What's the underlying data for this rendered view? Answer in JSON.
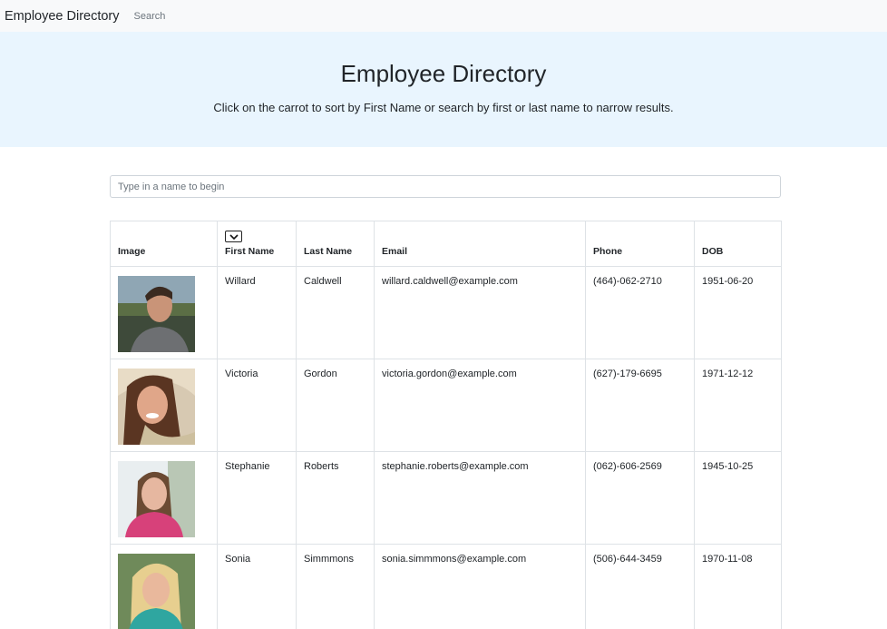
{
  "navbar": {
    "brand": "Employee Directory",
    "search_link": "Search"
  },
  "jumbotron": {
    "title": "Employee Directory",
    "subtitle": "Click on the carrot to sort by First Name or search by first or last name to narrow results."
  },
  "search": {
    "placeholder": "Type in a name to begin"
  },
  "table": {
    "headers": [
      "Image",
      "First Name",
      "Last Name",
      "Email",
      "Phone",
      "DOB"
    ],
    "rows": [
      {
        "first": "Willard",
        "last": "Caldwell",
        "email": "willard.caldwell@example.com",
        "phone": "(464)-062-2710",
        "dob": "1951-06-20"
      },
      {
        "first": "Victoria",
        "last": "Gordon",
        "email": "victoria.gordon@example.com",
        "phone": "(627)-179-6695",
        "dob": "1971-12-12"
      },
      {
        "first": "Stephanie",
        "last": "Roberts",
        "email": "stephanie.roberts@example.com",
        "phone": "(062)-606-2569",
        "dob": "1945-10-25"
      },
      {
        "first": "Sonia",
        "last": "Simmmons",
        "email": "sonia.simmmons@example.com",
        "phone": "(506)-644-3459",
        "dob": "1970-11-08"
      }
    ]
  },
  "icons": {
    "sort": "chevron-down-icon"
  }
}
